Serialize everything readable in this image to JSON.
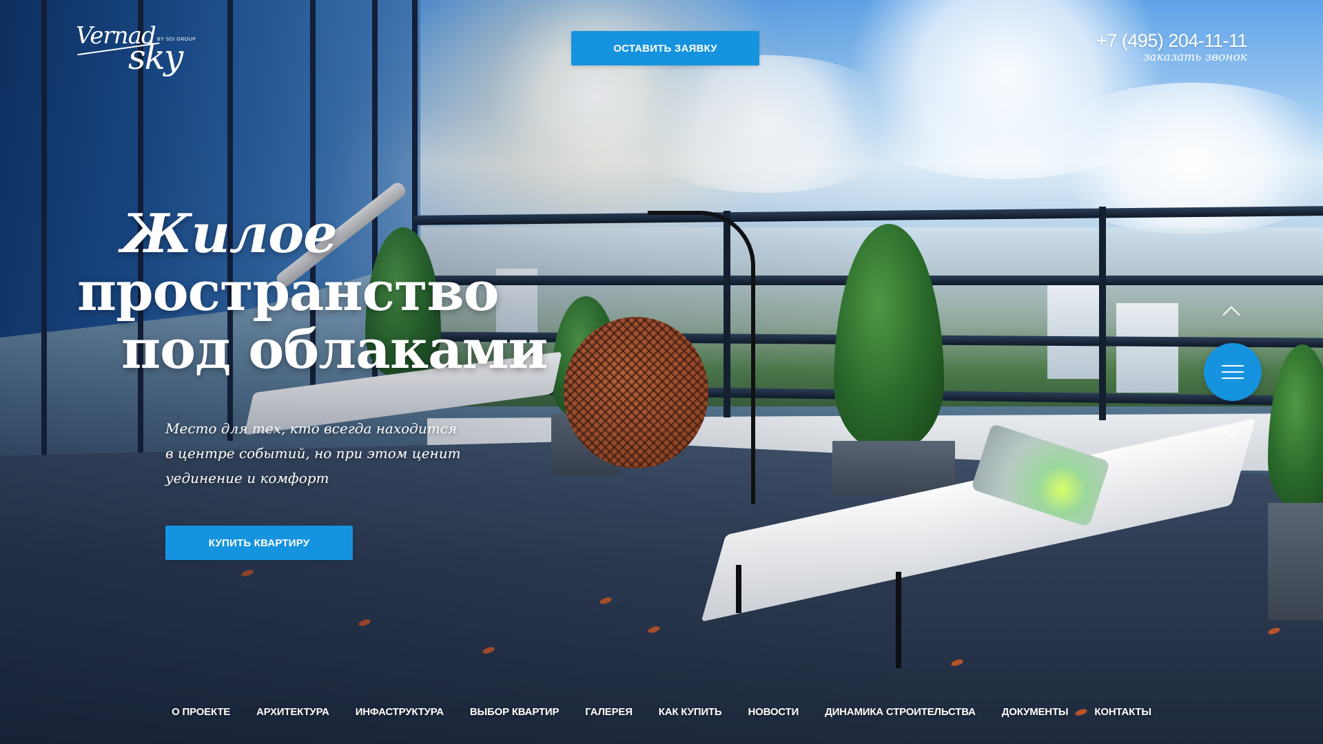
{
  "logo": {
    "top": "Vernad",
    "bottom": "sky",
    "sub": "BY SDI GROUP"
  },
  "header": {
    "request_button": "ОСТАВИТЬ ЗАЯВКУ",
    "phone": "+7 (495) 204-11-11",
    "callback": "заказать звонок"
  },
  "hero": {
    "headline_line1": "Жилое",
    "headline_line2": "пространство",
    "headline_line3": "под облаками",
    "tagline_line1": "Место для тех, кто всегда находится",
    "tagline_line2": "в центре событий, но при этом ценит",
    "tagline_line3": "уединение и комфорт",
    "buy_button": "КУПИТЬ КВАРТИРУ"
  },
  "slider": {
    "up_icon": "chevron-up-icon",
    "down_icon": "chevron-down-icon",
    "menu_icon": "hamburger-icon"
  },
  "nav": {
    "items": [
      "О ПРОЕКТЕ",
      "АРХИТЕКТУРА",
      "ИНФАСТРУКТУРА",
      "ВЫБОР КВАРТИР",
      "ГАЛЕРЕЯ",
      "КАК КУПИТЬ",
      "НОВОСТИ",
      "ДИНАМИКА СТРОИТЕЛЬСТВА",
      "ДОКУМЕНТЫ",
      "КОНТАКТЫ"
    ]
  },
  "colors": {
    "accent": "#1693de",
    "text": "#ffffff"
  }
}
